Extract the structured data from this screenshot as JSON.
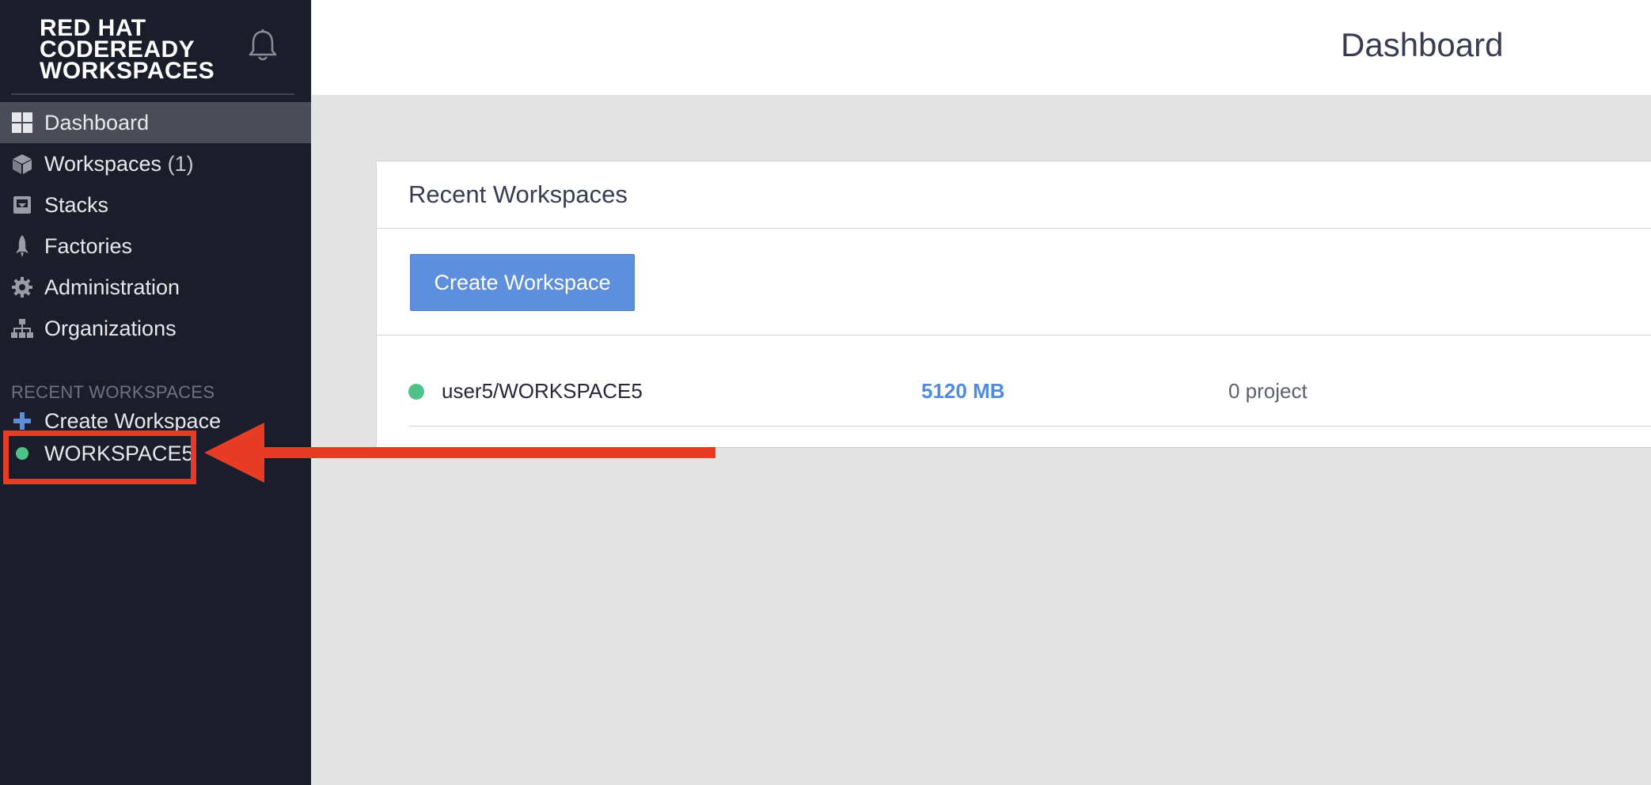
{
  "brand": {
    "line1": "RED HAT",
    "line2": "CODEREADY",
    "line3": "WORKSPACES"
  },
  "header": {
    "title": "Dashboard"
  },
  "sidebar": {
    "items": [
      {
        "label": "Dashboard",
        "icon": "dashboard-icon",
        "active": true
      },
      {
        "label": "Workspaces",
        "count": "(1)",
        "icon": "cube-icon"
      },
      {
        "label": "Stacks",
        "icon": "stacks-icon"
      },
      {
        "label": "Factories",
        "icon": "rocket-icon"
      },
      {
        "label": "Administration",
        "icon": "gear-icon"
      },
      {
        "label": "Organizations",
        "icon": "org-tree-icon"
      }
    ],
    "recent_title": "RECENT WORKSPACES",
    "recent_items": [
      {
        "label": "Create Workspace",
        "icon": "plus-icon"
      },
      {
        "label": "WORKSPACE5",
        "icon": "status-dot-icon",
        "status_color": "#4fc287"
      }
    ]
  },
  "panel": {
    "title": "Recent Workspaces",
    "create_button": "Create Workspace",
    "workspaces": [
      {
        "name": "user5/WORKSPACE5",
        "memory": "5120 MB",
        "projects": "0 project",
        "status_color": "#4fc287"
      }
    ]
  },
  "colors": {
    "sidebar_bg": "#1b1d2a",
    "accent": "#5d8fdc",
    "running": "#4fc287",
    "annotation": "#e63c25"
  }
}
